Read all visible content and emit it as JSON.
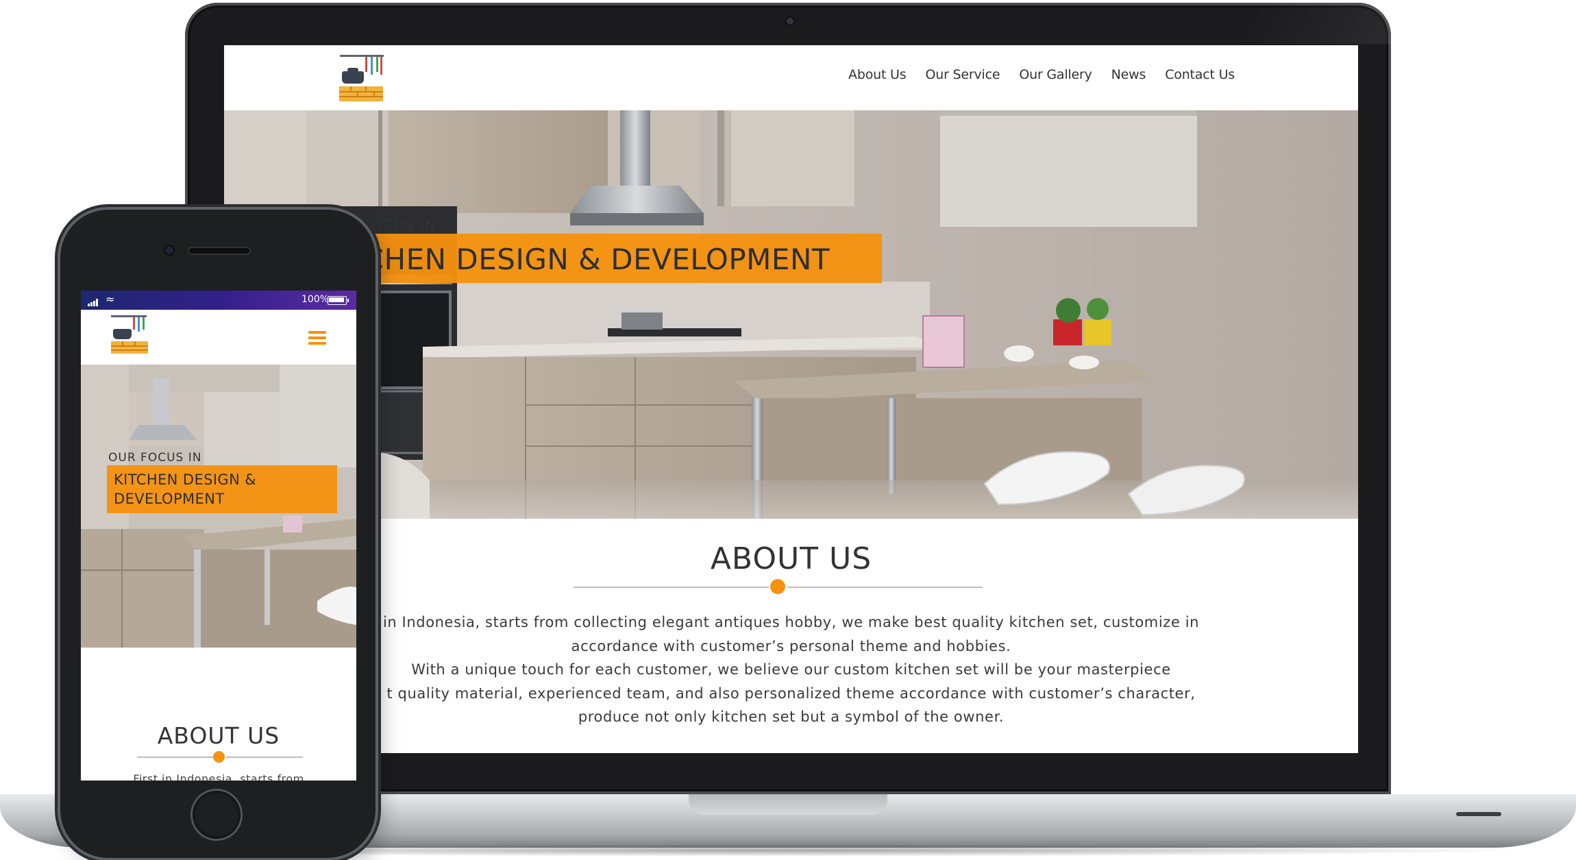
{
  "colors": {
    "accent": "#f5920f",
    "text": "#333333",
    "device_frame": "#1b1b1d",
    "status_bar_start": "#1b2870",
    "status_bar_end": "#5a2ba3"
  },
  "desktop": {
    "logo_icon": "kitchen-pot-on-bricks-logo",
    "nav": [
      "About Us",
      "Our Service",
      "Our Gallery",
      "News",
      "Contact Us"
    ],
    "hero": {
      "kicker": "R FOCUS IN",
      "title": "TCHEN DESIGN & DEVELOPMENT"
    },
    "about": {
      "title": "ABOUT US",
      "lines": [
        "in Indonesia, starts from collecting elegant antiques hobby, we make best quality kitchen set, customize in",
        "accordance with customer’s personal theme and hobbies.",
        "With a unique touch for each customer, we believe our custom kitchen set will be your masterpiece",
        "t quality material, experienced team, and also personalized theme accordance with customer’s character,",
        "produce not only kitchen set but a symbol of the owner."
      ]
    }
  },
  "mobile": {
    "status": {
      "battery_text": "100%",
      "signal_icon": "signal-bars-icon",
      "wifi_icon": "wifi-icon",
      "battery_icon": "battery-icon"
    },
    "logo_icon": "kitchen-pot-on-bricks-logo",
    "menu_icon": "hamburger-menu-icon",
    "hero": {
      "kicker": "OUR FOCUS IN",
      "title": "KITCHEN DESIGN & DEVELOPMENT"
    },
    "about": {
      "title": "ABOUT US",
      "text": "First in Indonesia, starts from"
    }
  }
}
